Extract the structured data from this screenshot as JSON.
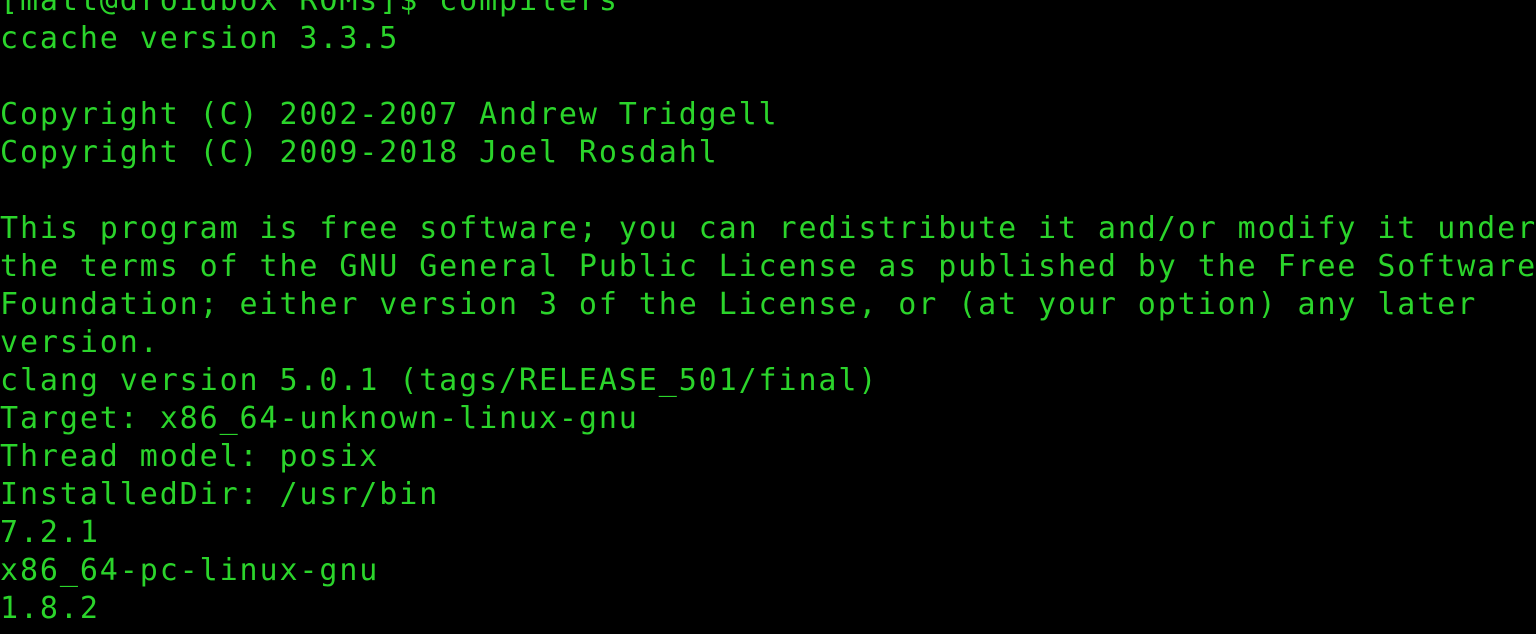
{
  "theme": {
    "background": "#000000",
    "text_color": "#2bd42b"
  },
  "terminal": {
    "prompt_line": "[matt@droidbox ROMs]$ compilers",
    "ccache_version": "ccache version 3.3.5",
    "copyright_1": "Copyright (C) 2002-2007 Andrew Tridgell",
    "copyright_2": "Copyright (C) 2009-2018 Joel Rosdahl",
    "license_1": "This program is free software; you can redistribute it and/or modify it under",
    "license_2": "the terms of the GNU General Public License as published by the Free Software",
    "license_3": "Foundation; either version 3 of the License, or (at your option) any later",
    "license_4": "version.",
    "clang_version": "clang version 5.0.1 (tags/RELEASE_501/final)",
    "target": "Target: x86_64-unknown-linux-gnu",
    "thread_model": "Thread model: posix",
    "installed_dir": "InstalledDir: /usr/bin",
    "gcc_version": "7.2.1",
    "gcc_target": "x86_64-pc-linux-gnu",
    "last_version": "1.8.2"
  }
}
